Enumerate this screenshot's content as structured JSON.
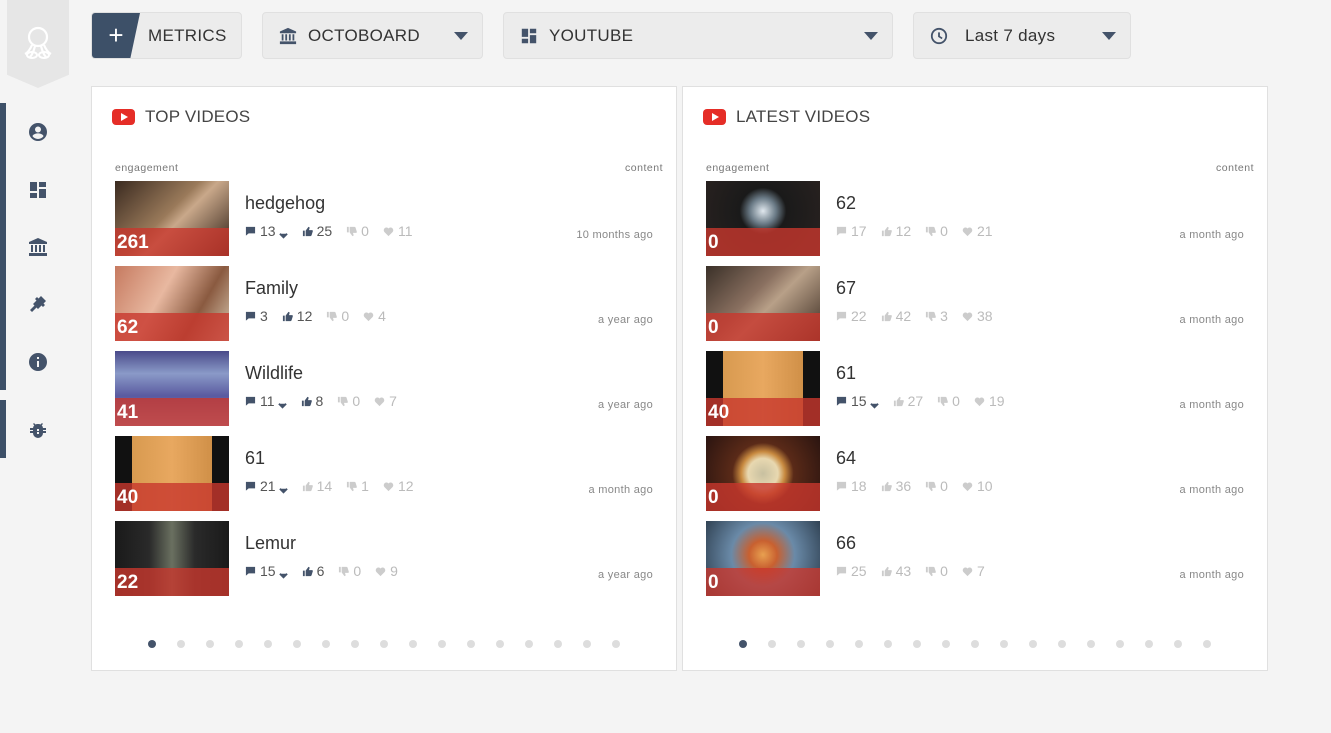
{
  "toolbar": {
    "metrics_label": "METRICS",
    "board_select": "OCTOBOARD",
    "source_select": "YOUTUBE",
    "period_select": "Last 7 days"
  },
  "panels": [
    {
      "title": "TOP VIDEOS",
      "col_left": "engagement",
      "col_right": "content",
      "videos": [
        {
          "title": "hedgehog",
          "score": "261",
          "comments": "13",
          "likes": "25",
          "dislikes": "0",
          "favs": "11",
          "time": "10 months ago"
        },
        {
          "title": "Family",
          "score": "62",
          "comments": "3",
          "likes": "12",
          "dislikes": "0",
          "favs": "4",
          "time": "a year ago"
        },
        {
          "title": "Wildlife",
          "score": "41",
          "comments": "11",
          "likes": "8",
          "dislikes": "0",
          "favs": "7",
          "time": "a year ago"
        },
        {
          "title": "61",
          "score": "40",
          "comments": "21",
          "likes": "14",
          "dislikes": "1",
          "favs": "12",
          "time": "a month ago"
        },
        {
          "title": "Lemur",
          "score": "22",
          "comments": "15",
          "likes": "6",
          "dislikes": "0",
          "favs": "9",
          "time": "a year ago"
        }
      ]
    },
    {
      "title": "LATEST VIDEOS",
      "col_left": "engagement",
      "col_right": "content",
      "videos": [
        {
          "title": "62",
          "score": "0",
          "comments": "17",
          "likes": "12",
          "dislikes": "0",
          "favs": "21",
          "time": "a month ago"
        },
        {
          "title": "67",
          "score": "0",
          "comments": "22",
          "likes": "42",
          "dislikes": "3",
          "favs": "38",
          "time": "a month ago"
        },
        {
          "title": "61",
          "score": "40",
          "comments": "15",
          "likes": "27",
          "dislikes": "0",
          "favs": "19",
          "time": "a month ago"
        },
        {
          "title": "64",
          "score": "0",
          "comments": "18",
          "likes": "36",
          "dislikes": "0",
          "favs": "10",
          "time": "a month ago"
        },
        {
          "title": "66",
          "score": "0",
          "comments": "25",
          "likes": "43",
          "dislikes": "0",
          "favs": "7",
          "time": "a month ago"
        }
      ]
    }
  ],
  "sidebar": {
    "icons": [
      "user-circle-icon",
      "dashboard-icon",
      "bank-icon",
      "plug-icon",
      "info-icon",
      "bug-icon"
    ]
  },
  "colors": {
    "accent": "#3d5068",
    "youtube_red": "#e52d27",
    "overlay_red": "#c8372d"
  }
}
